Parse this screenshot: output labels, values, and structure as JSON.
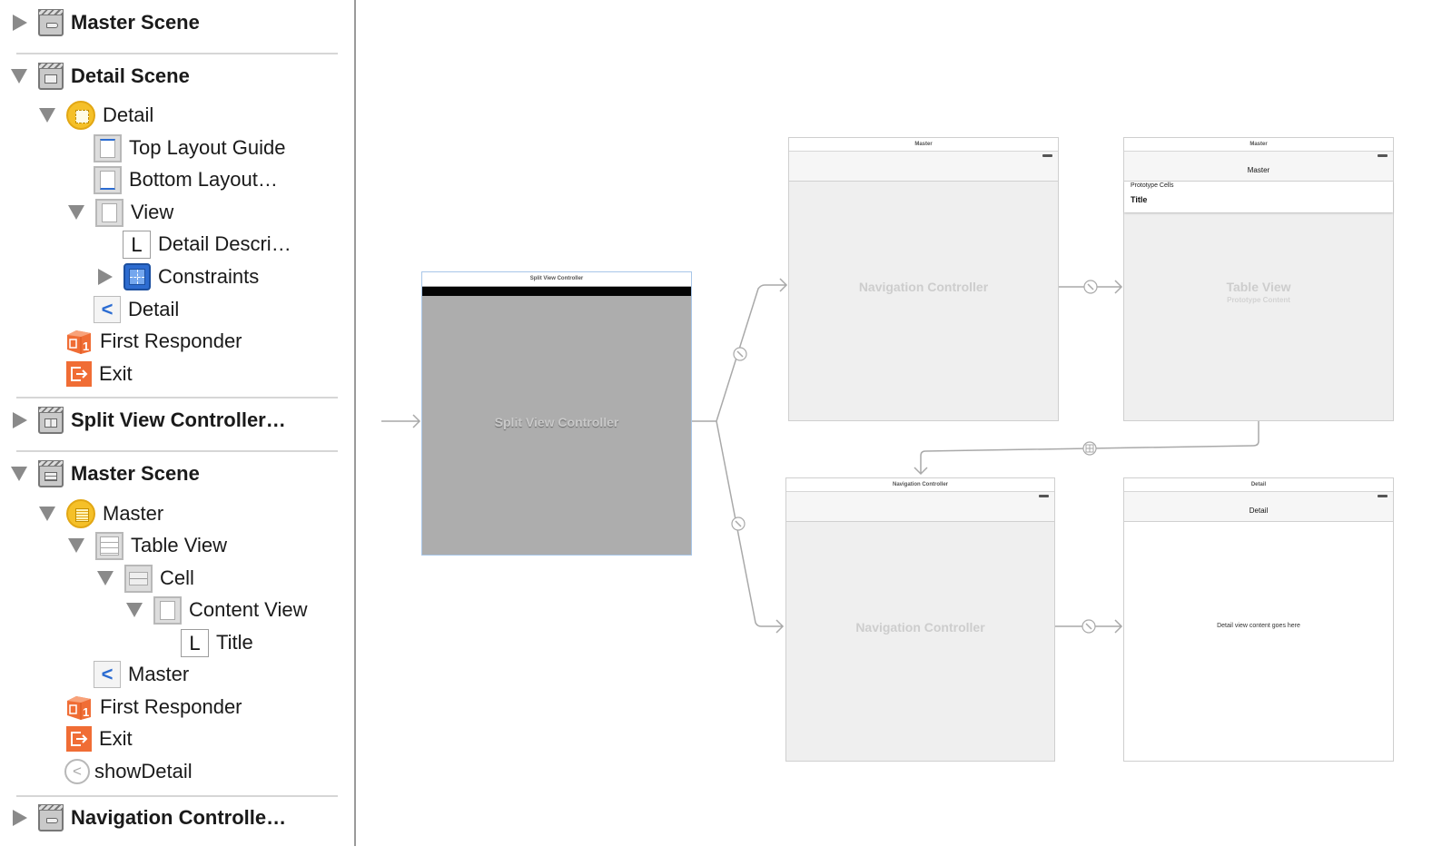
{
  "outline": {
    "items": [
      {
        "label": "Master Scene",
        "kind": "scene",
        "icon": "scene-nav-icon",
        "disclosure": "closed"
      },
      {
        "label": "Detail Scene",
        "kind": "scene",
        "icon": "scene-view-icon",
        "disclosure": "open"
      },
      {
        "label": "Detail",
        "icon": "view-controller-icon",
        "disclosure": "open"
      },
      {
        "label": "Top Layout Guide",
        "icon": "top-layout-guide-icon"
      },
      {
        "label": "Bottom Layout…",
        "icon": "bottom-layout-guide-icon"
      },
      {
        "label": "View",
        "icon": "view-icon",
        "disclosure": "open"
      },
      {
        "label": "Detail Descri…",
        "icon": "label-icon",
        "icon_glyph": "L"
      },
      {
        "label": "Constraints",
        "icon": "constraints-icon",
        "disclosure": "closed"
      },
      {
        "label": "Detail",
        "icon": "navigation-item-icon",
        "icon_glyph": "<"
      },
      {
        "label": "First Responder",
        "icon": "first-responder-icon"
      },
      {
        "label": "Exit",
        "icon": "exit-icon"
      },
      {
        "label": "Split View Controller…",
        "kind": "scene",
        "icon": "scene-split-icon",
        "disclosure": "closed"
      },
      {
        "label": "Master Scene",
        "kind": "scene",
        "icon": "scene-table-icon",
        "disclosure": "open"
      },
      {
        "label": "Master",
        "icon": "table-view-controller-icon",
        "disclosure": "open"
      },
      {
        "label": "Table View",
        "icon": "table-view-icon",
        "disclosure": "open"
      },
      {
        "label": "Cell",
        "icon": "table-cell-icon",
        "disclosure": "open"
      },
      {
        "label": "Content View",
        "icon": "view-icon",
        "disclosure": "open"
      },
      {
        "label": "Title",
        "icon": "label-icon",
        "icon_glyph": "L"
      },
      {
        "label": "Master",
        "icon": "navigation-item-icon",
        "icon_glyph": "<"
      },
      {
        "label": "First Responder",
        "icon": "first-responder-icon"
      },
      {
        "label": "Exit",
        "icon": "exit-icon"
      },
      {
        "label": "showDetail",
        "icon": "segue-icon",
        "icon_glyph": "<"
      },
      {
        "label": "Navigation Controlle…",
        "kind": "scene",
        "icon": "scene-nav-icon",
        "disclosure": "closed"
      }
    ]
  },
  "canvas": {
    "split_view": {
      "title": "Split View Controller",
      "placeholder": "Split View Controller"
    },
    "master_nav": {
      "title": "Master",
      "placeholder": "Navigation Controller"
    },
    "master_table": {
      "title": "Master",
      "nav_title": "Master",
      "prototype_label": "Prototype Cells",
      "cell_title": "Title",
      "placeholder": "Table View",
      "placeholder_sub": "Prototype Content"
    },
    "detail_nav": {
      "title": "Navigation Controller",
      "placeholder": "Navigation Controller"
    },
    "detail": {
      "title": "Detail",
      "nav_title": "Detail",
      "content": "Detail view content goes here"
    }
  }
}
